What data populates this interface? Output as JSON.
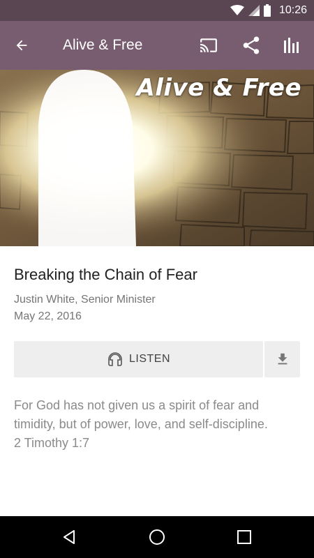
{
  "status_bar": {
    "time": "10:26"
  },
  "app_bar": {
    "title": "Alive & Free"
  },
  "hero": {
    "overlay_text": "Alive & Free"
  },
  "sermon": {
    "title": "Breaking the Chain of Fear",
    "speaker": "Justin White, Senior Minister",
    "date": "May 22, 2016",
    "listen_label": "LISTEN",
    "description_line1": "For God has not given us a spirit of fear and",
    "description_line2": "timidity, but of power, love, and self-discipline.",
    "description_line3": "2 Timothy 1:7"
  },
  "icons": {
    "back": "arrow-back-icon",
    "cast": "cast-icon",
    "share": "share-icon",
    "equalizer": "equalizer-icon",
    "headphones": "headphones-icon",
    "download": "download-icon"
  },
  "colors": {
    "status_bar": "#5a4552",
    "app_bar": "#785c6f",
    "button_bg": "#eeeeee"
  }
}
